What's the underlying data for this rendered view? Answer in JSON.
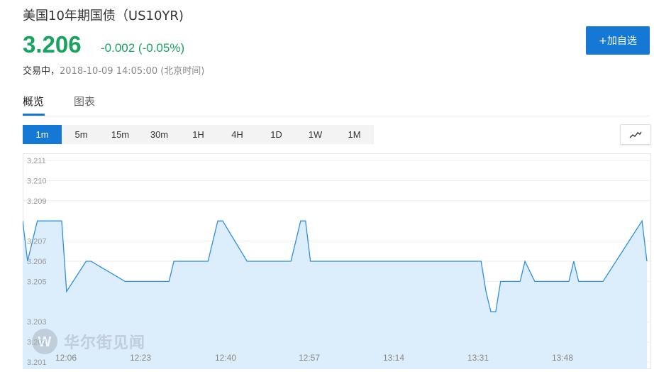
{
  "header": {
    "title": "美国10年期国债（US10YR)",
    "price": "3.206",
    "change": "-0.002 (-0.05%)",
    "status_label": "交易中，",
    "timestamp": "2018-10-09 14:05:00 (北京时间)",
    "add_button": "+加自选"
  },
  "tabs": [
    {
      "label": "概览",
      "active": true
    },
    {
      "label": "图表",
      "active": false
    }
  ],
  "periods": [
    {
      "label": "1m",
      "active": true
    },
    {
      "label": "5m",
      "active": false
    },
    {
      "label": "15m",
      "active": false
    },
    {
      "label": "30m",
      "active": false
    },
    {
      "label": "1H",
      "active": false
    },
    {
      "label": "4H",
      "active": false
    },
    {
      "label": "1D",
      "active": false
    },
    {
      "label": "1W",
      "active": false
    },
    {
      "label": "1M",
      "active": false
    }
  ],
  "chart_type_icon": "line-chart-icon",
  "watermark": "华尔街见闻",
  "colors": {
    "up_green": "#1aa260",
    "accent_blue": "#1478d4",
    "line": "#2f8ee0",
    "area": "#dcedfb"
  },
  "chart_data": {
    "type": "area",
    "ylim": [
      3.201,
      3.211
    ],
    "y_ticks": [
      "3.211",
      "3.210",
      "3.209",
      "3.207",
      "3.206",
      "3.205",
      "3.203",
      "3.202",
      "3.201"
    ],
    "y_tick_values": [
      3.211,
      3.21,
      3.209,
      3.207,
      3.206,
      3.205,
      3.203,
      3.202,
      3.201
    ],
    "x_ticks": [
      "12:06",
      "12:23",
      "12:40",
      "12:57",
      "13:14",
      "13:31",
      "13:48"
    ],
    "grid": true,
    "x": [
      0,
      1,
      3,
      8,
      9,
      13,
      14,
      21,
      22,
      30,
      31,
      37,
      38,
      40,
      41,
      46,
      47,
      55,
      57,
      58,
      59,
      94,
      95,
      96,
      97,
      98,
      99,
      100,
      102,
      103,
      105,
      106,
      107,
      108,
      111,
      112,
      113,
      114,
      115,
      119,
      127,
      128
    ],
    "y": [
      3.208,
      3.206,
      3.208,
      3.208,
      3.2045,
      3.206,
      3.206,
      3.205,
      3.205,
      3.205,
      3.206,
      3.206,
      3.206,
      3.208,
      3.208,
      3.206,
      3.206,
      3.206,
      3.208,
      3.208,
      3.206,
      3.206,
      3.2045,
      3.2035,
      3.2035,
      3.205,
      3.205,
      3.205,
      3.205,
      3.206,
      3.205,
      3.205,
      3.205,
      3.205,
      3.205,
      3.205,
      3.206,
      3.205,
      3.205,
      3.205,
      3.208,
      3.206
    ]
  }
}
